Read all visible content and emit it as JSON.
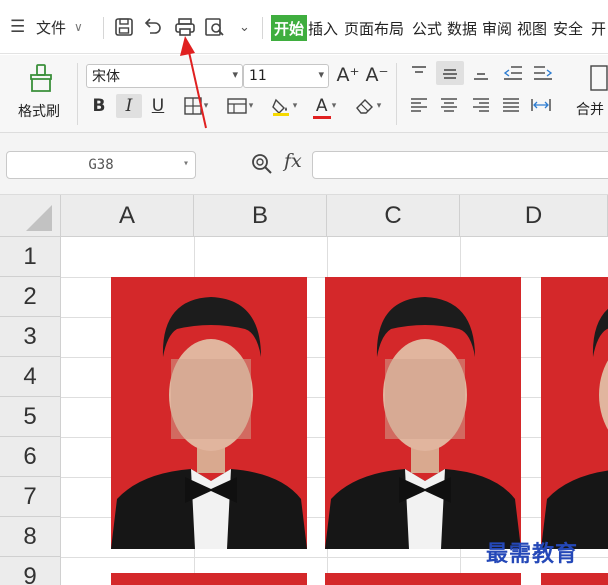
{
  "menubar": {
    "file_label": "文件",
    "tabs": [
      "开始",
      "插入",
      "页面布局",
      "公式",
      "数据",
      "审阅",
      "视图",
      "安全",
      "开"
    ],
    "active_tab": "开始"
  },
  "ribbon": {
    "format_painter_label": "格式刷",
    "font_name": "宋体",
    "font_size": "11",
    "bold": "B",
    "italic": "I",
    "underline": "U",
    "font_color_glyph": "A",
    "font_grow": "A⁺",
    "font_shrink": "A⁻",
    "merge_label": "合并",
    "colors": {
      "fill_highlight": "#f6d900",
      "font_color": "#e02020"
    }
  },
  "formula_bar": {
    "cell_reference": "G38",
    "fx_label": "fx",
    "formula_value": ""
  },
  "sheet": {
    "column_headers": [
      "A",
      "B",
      "C",
      "D"
    ],
    "row_headers": [
      "1",
      "2",
      "3",
      "4",
      "5",
      "6",
      "7",
      "8",
      "9"
    ],
    "photo_background_color": "#d4282a"
  },
  "watermark": {
    "text": "最需教育"
  },
  "annotation": {
    "arrow_color": "#e02020"
  }
}
